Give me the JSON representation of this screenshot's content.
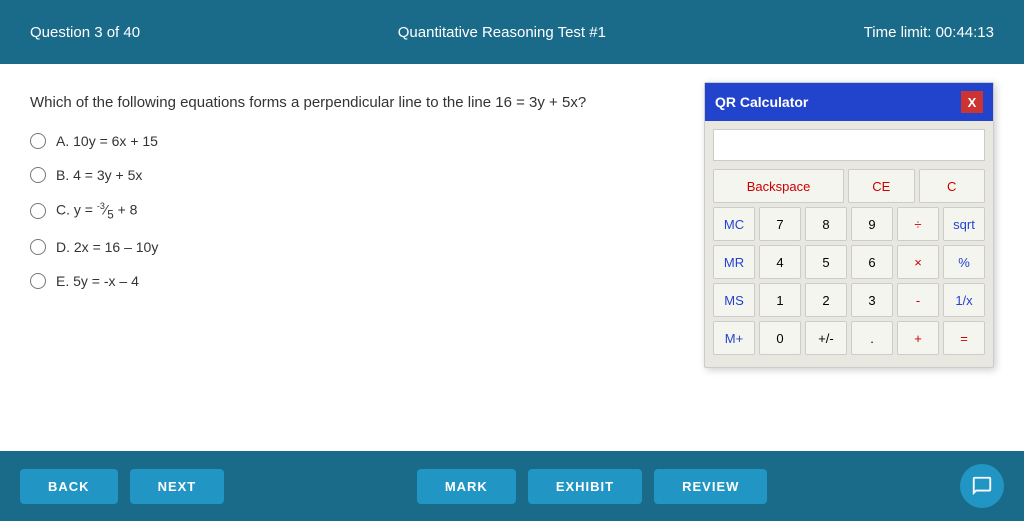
{
  "header": {
    "question_counter": "Question 3 of 40",
    "test_title": "Quantitative Reasoning Test #1",
    "time_label": "Time limit: 00:44:13"
  },
  "question": {
    "text": "Which of the following equations forms a perpendicular line to the line 16 = 3y + 5x?",
    "options": [
      {
        "id": "A",
        "label": "A. 10y = 6x + 15"
      },
      {
        "id": "B",
        "label": "B. 4 = 3y + 5x"
      },
      {
        "id": "C",
        "label": "C. y = "
      },
      {
        "id": "D",
        "label": "D. 2x = 16 – 10y"
      },
      {
        "id": "E",
        "label": "E. 5y = -x – 4"
      }
    ]
  },
  "calculator": {
    "title": "QR Calculator",
    "close_label": "X",
    "buttons": {
      "row1": [
        "Backspace",
        "CE",
        "C"
      ],
      "row2": [
        "MC",
        "7",
        "8",
        "9",
        "÷",
        "sqrt"
      ],
      "row3": [
        "MR",
        "4",
        "5",
        "6",
        "×",
        "%"
      ],
      "row4": [
        "MS",
        "1",
        "2",
        "3",
        "-",
        "1/x"
      ],
      "row5": [
        "M+",
        "0",
        "+/-",
        ".",
        "+",
        "="
      ]
    }
  },
  "footer": {
    "back_label": "BACK",
    "next_label": "NEXT",
    "mark_label": "MARK",
    "exhibit_label": "EXHIBIT",
    "review_label": "REVIEW"
  }
}
